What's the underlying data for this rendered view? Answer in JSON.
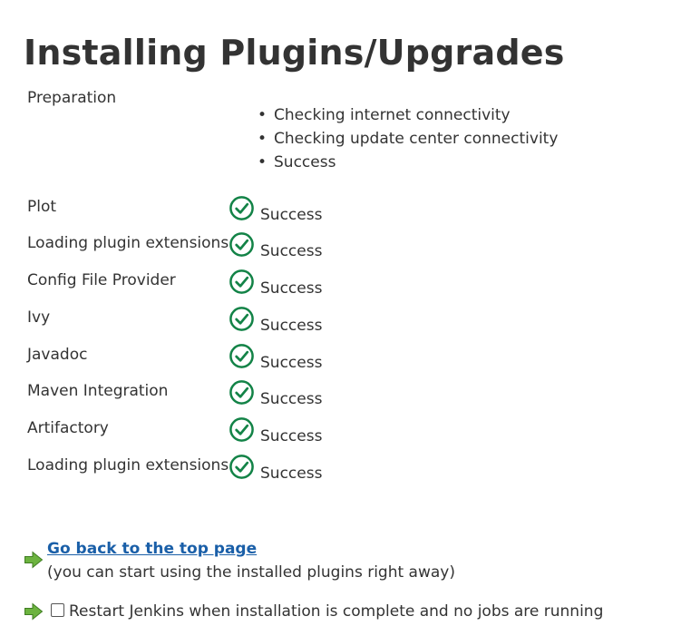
{
  "page": {
    "title": "Installing Plugins/Upgrades"
  },
  "preparation": {
    "label": "Preparation",
    "steps": [
      "Checking internet connectivity",
      "Checking update center connectivity",
      "Success"
    ]
  },
  "plugins": [
    {
      "name": "Plot",
      "status": "Success",
      "icon": "check-circle-icon"
    },
    {
      "name": "Loading plugin extensions",
      "status": "Success",
      "icon": "check-circle-icon"
    },
    {
      "name": "Config File Provider",
      "status": "Success",
      "icon": "check-circle-icon"
    },
    {
      "name": "Ivy",
      "status": "Success",
      "icon": "check-circle-icon"
    },
    {
      "name": "Javadoc",
      "status": "Success",
      "icon": "check-circle-icon"
    },
    {
      "name": "Maven Integration",
      "status": "Success",
      "icon": "check-circle-icon"
    },
    {
      "name": "Artifactory",
      "status": "Success",
      "icon": "check-circle-icon"
    },
    {
      "name": "Loading plugin extensions",
      "status": "Success",
      "icon": "check-circle-icon"
    }
  ],
  "footer": {
    "back_link": "Go back to the top page",
    "back_note": "(you can start using the installed plugins right away)",
    "restart_label": "Restart Jenkins when installation is complete and no jobs are running",
    "restart_checked": false
  },
  "colors": {
    "success_green": "#138347",
    "arrow_green": "#6cb33f",
    "link_blue": "#1a5fa8",
    "text": "#333333"
  }
}
